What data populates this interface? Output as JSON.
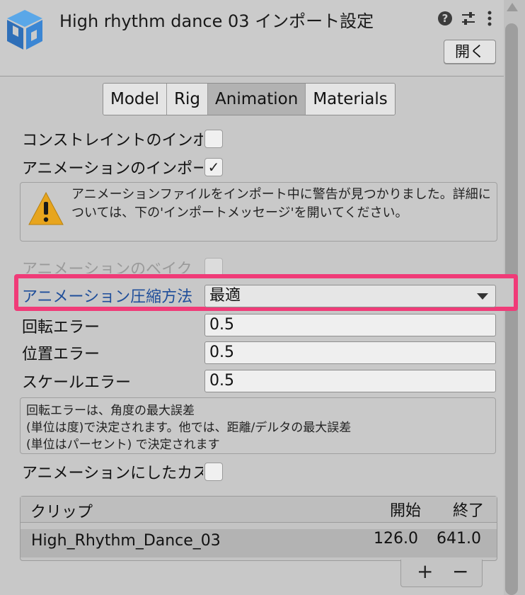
{
  "header": {
    "title": "High rhythm dance 03 インポート設定",
    "open_label": "開く",
    "icons": [
      "unity-model-icon",
      "help-icon",
      "sliders-icon",
      "more-vert-icon"
    ]
  },
  "tabs": [
    {
      "label": "Model"
    },
    {
      "label": "Rig"
    },
    {
      "label": "Animation",
      "active": true
    },
    {
      "label": "Materials"
    }
  ],
  "import_constraints": {
    "label": "コンストレイントのインポート",
    "checked": false
  },
  "import_animation": {
    "label": "アニメーションのインポート",
    "checked": true,
    "check_glyph": "✓"
  },
  "warning": {
    "text": "アニメーションファイルをインポート中に警告が見つかりました。詳細については、下の'インポートメッセージ'を開いてください。"
  },
  "bake_animations": {
    "label": "アニメーションのベイク"
  },
  "compression": {
    "label": "アニメーション圧縮方法",
    "value": "最適"
  },
  "rotation_error": {
    "label": "回転エラー",
    "value": "0.5"
  },
  "position_error": {
    "label": "位置エラー",
    "value": "0.5"
  },
  "scale_error": {
    "label": "スケールエラー",
    "value": "0.5"
  },
  "error_info": {
    "line1": "回転エラーは、角度の最大誤差",
    "line2": "(単位は度)で決定されます。他では、距離/デルタの最大誤差",
    "line3": "(単位はパーセント) で決定されます"
  },
  "anim_custom_props": {
    "label": "アニメーションにしたカスタムプロパティ",
    "checked": false
  },
  "clips": {
    "header_clip": "クリップ",
    "header_start": "開始",
    "header_end": "終了",
    "rows": [
      {
        "name": "High_Rhythm_Dance_03",
        "start": "126.0",
        "end": "641.0"
      }
    ],
    "add_label": "+",
    "remove_label": "−"
  },
  "colors": {
    "highlight": "#f03b78",
    "link_blue": "#1f4e9a"
  }
}
